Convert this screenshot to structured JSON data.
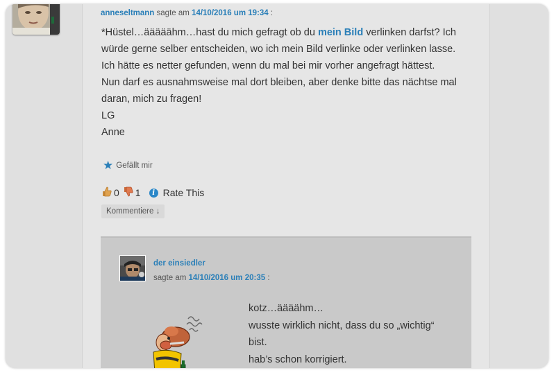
{
  "colors": {
    "link": "#2a7fb8",
    "card": "#e6e6e6",
    "reply_box": "#c9c9c9"
  },
  "comment": {
    "author": "anneseltmann",
    "said_on": "sagte am",
    "date": "14/10/2016 um 19:34",
    "colon": ":",
    "lines": [
      {
        "before": "*Hüstel…ääääähm…hast du mich gefragt ob du ",
        "link": "mein Bild",
        "after": " verlinken darfst? Ich"
      },
      {
        "text": "würde gerne selber entscheiden, wo ich mein Bild verlinke oder verlinken lasse."
      },
      {
        "text": "Ich hätte es netter gefunden, wenn du mal bei mir vorher angefragt hättest."
      },
      {
        "text": "Nun darf es ausnahmsweise mal dort bleiben, aber denke bitte das nächtse mal"
      },
      {
        "text": "daran, mich zu fragen!"
      },
      {
        "text": "LG"
      },
      {
        "text": "Anne"
      }
    ],
    "like_icon": "star-icon",
    "like_label": "Gefällt mir",
    "thumbs_up_count": "0",
    "thumbs_down_count": "1",
    "rate_label": "Rate This",
    "reply_label": "Kommentiere ↓"
  },
  "reply": {
    "author": "der einsiedler",
    "said_on": "sagte am",
    "date": "14/10/2016 um 20:35",
    "colon": ":",
    "lines": [
      "kotz…äääähm…",
      "wusste wirklich nicht, dass du so „wichtig“",
      "bist.",
      "hab’s schon korrigiert."
    ]
  }
}
